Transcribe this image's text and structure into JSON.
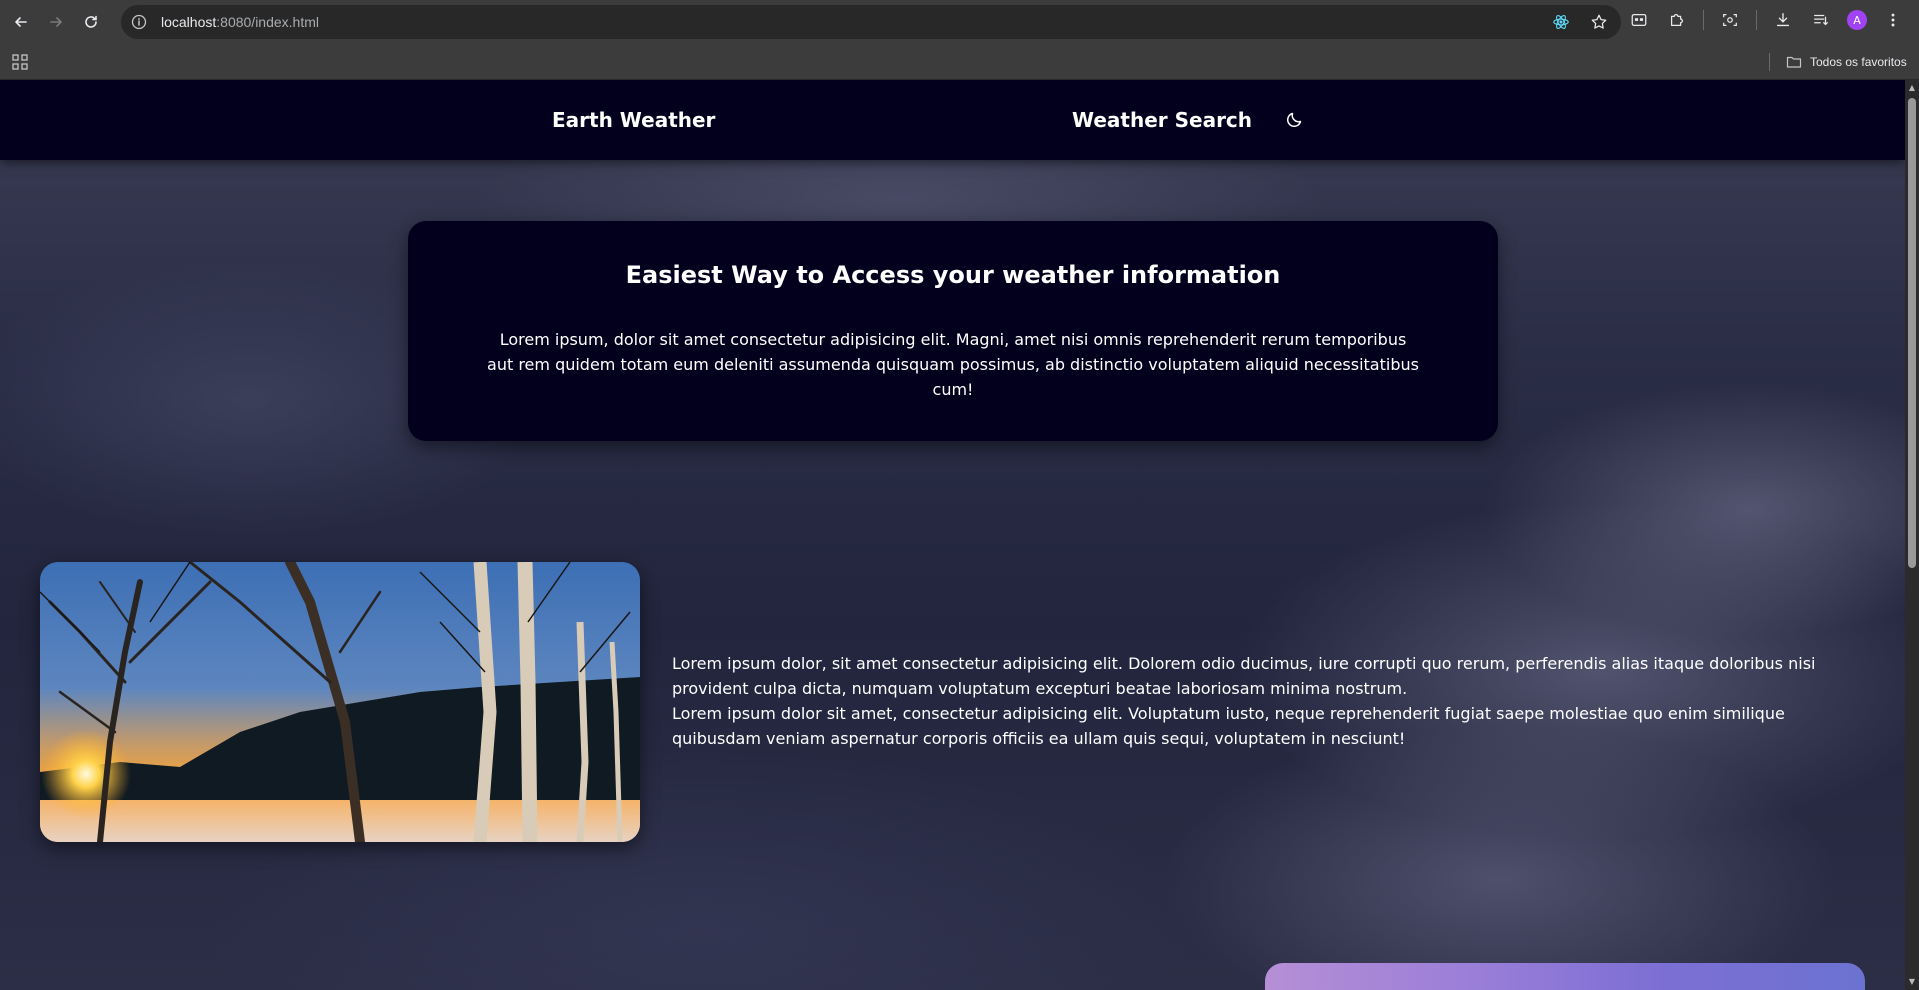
{
  "browser": {
    "url_host": "localhost",
    "url_rest": ":8080/index.html",
    "bookmarks_folder": "Todos os favoritos",
    "avatar_letter": "A"
  },
  "site": {
    "brand": "Earth Weather",
    "nav_link": "Weather Search",
    "theme_icon": "moon-icon"
  },
  "hero": {
    "title": "Easiest Way to Access your weather information",
    "text": "Lorem ipsum, dolor sit amet consectetur adipisicing elit. Magni, amet nisi omnis reprehenderit rerum temporibus aut rem quidem totam eum deleniti assumenda quisquam possimus, ab distinctio voluptatem aliquid necessitatibus cum!"
  },
  "feature": {
    "paragraph1": "Lorem ipsum dolor, sit amet consectetur adipisicing elit. Dolorem odio ducimus, iure corrupti quo rerum, perferendis alias itaque doloribus nisi provident culpa dicta, numquam voluptatum excepturi beatae laboriosam minima nostrum.",
    "paragraph2": "Lorem ipsum dolor sit amet, consectetur adipisicing elit. Voluptatum iusto, neque reprehenderit fugiat saepe molestiae quo enim similique quibusdam veniam aspernatur corporis officiis ea ullam quis sequi, voluptatem in nesciunt!"
  },
  "colors": {
    "header_bg": "#02001d",
    "card_bg": "#02001d",
    "text": "#ffffff"
  }
}
